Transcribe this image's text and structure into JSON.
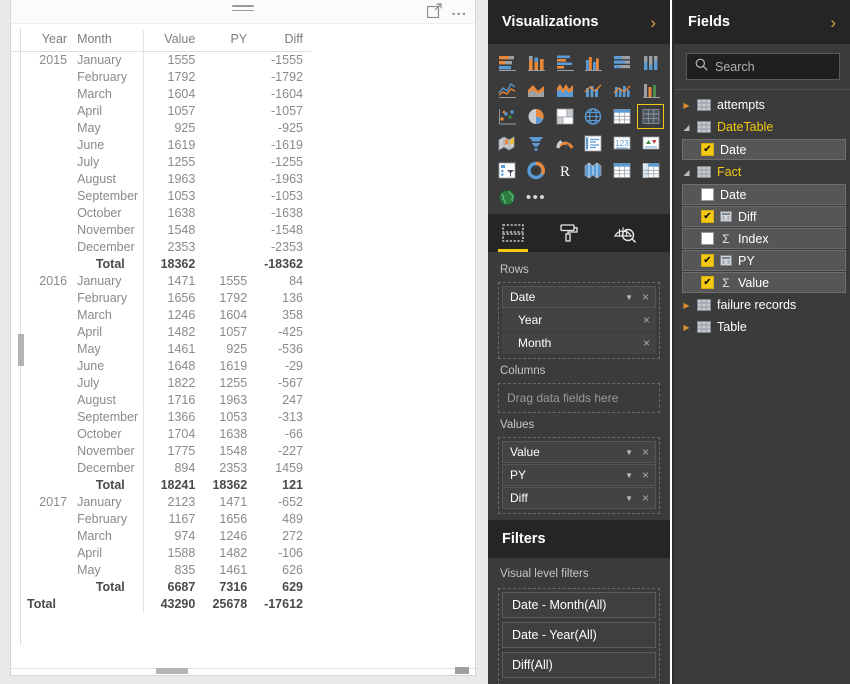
{
  "visual": {
    "drag_handle": "drag-handle",
    "focus_mode_label": "focus-mode",
    "more_options_label": "...",
    "columns": [
      "Year",
      "Month",
      "Value",
      "PY",
      "Diff"
    ],
    "rows": [
      {
        "type": "data",
        "year": "2015",
        "month": "January",
        "value": "1555",
        "py": "",
        "diff": "-1555"
      },
      {
        "type": "data",
        "year": "",
        "month": "February",
        "value": "1792",
        "py": "",
        "diff": "-1792"
      },
      {
        "type": "data",
        "year": "",
        "month": "March",
        "value": "1604",
        "py": "",
        "diff": "-1604"
      },
      {
        "type": "data",
        "year": "",
        "month": "April",
        "value": "1057",
        "py": "",
        "diff": "-1057"
      },
      {
        "type": "data",
        "year": "",
        "month": "May",
        "value": "925",
        "py": "",
        "diff": "-925"
      },
      {
        "type": "data",
        "year": "",
        "month": "June",
        "value": "1619",
        "py": "",
        "diff": "-1619"
      },
      {
        "type": "data",
        "year": "",
        "month": "July",
        "value": "1255",
        "py": "",
        "diff": "-1255"
      },
      {
        "type": "data",
        "year": "",
        "month": "August",
        "value": "1963",
        "py": "",
        "diff": "-1963"
      },
      {
        "type": "data",
        "year": "",
        "month": "September",
        "value": "1053",
        "py": "",
        "diff": "-1053"
      },
      {
        "type": "data",
        "year": "",
        "month": "October",
        "value": "1638",
        "py": "",
        "diff": "-1638"
      },
      {
        "type": "data",
        "year": "",
        "month": "November",
        "value": "1548",
        "py": "",
        "diff": "-1548"
      },
      {
        "type": "data",
        "year": "",
        "month": "December",
        "value": "2353",
        "py": "",
        "diff": "-2353"
      },
      {
        "type": "total",
        "year": "",
        "month": "Total",
        "value": "18362",
        "py": "",
        "diff": "-18362"
      },
      {
        "type": "data",
        "year": "2016",
        "month": "January",
        "value": "1471",
        "py": "1555",
        "diff": "84"
      },
      {
        "type": "data",
        "year": "",
        "month": "February",
        "value": "1656",
        "py": "1792",
        "diff": "136"
      },
      {
        "type": "data",
        "year": "",
        "month": "March",
        "value": "1246",
        "py": "1604",
        "diff": "358"
      },
      {
        "type": "data",
        "year": "",
        "month": "April",
        "value": "1482",
        "py": "1057",
        "diff": "-425"
      },
      {
        "type": "data",
        "year": "",
        "month": "May",
        "value": "1461",
        "py": "925",
        "diff": "-536"
      },
      {
        "type": "data",
        "year": "",
        "month": "June",
        "value": "1648",
        "py": "1619",
        "diff": "-29"
      },
      {
        "type": "data",
        "year": "",
        "month": "July",
        "value": "1822",
        "py": "1255",
        "diff": "-567"
      },
      {
        "type": "data",
        "year": "",
        "month": "August",
        "value": "1716",
        "py": "1963",
        "diff": "247"
      },
      {
        "type": "data",
        "year": "",
        "month": "September",
        "value": "1366",
        "py": "1053",
        "diff": "-313"
      },
      {
        "type": "data",
        "year": "",
        "month": "October",
        "value": "1704",
        "py": "1638",
        "diff": "-66"
      },
      {
        "type": "data",
        "year": "",
        "month": "November",
        "value": "1775",
        "py": "1548",
        "diff": "-227"
      },
      {
        "type": "data",
        "year": "",
        "month": "December",
        "value": "894",
        "py": "2353",
        "diff": "1459"
      },
      {
        "type": "total",
        "year": "",
        "month": "Total",
        "value": "18241",
        "py": "18362",
        "diff": "121"
      },
      {
        "type": "data",
        "year": "2017",
        "month": "January",
        "value": "2123",
        "py": "1471",
        "diff": "-652"
      },
      {
        "type": "data",
        "year": "",
        "month": "February",
        "value": "1167",
        "py": "1656",
        "diff": "489"
      },
      {
        "type": "data",
        "year": "",
        "month": "March",
        "value": "974",
        "py": "1246",
        "diff": "272"
      },
      {
        "type": "data",
        "year": "",
        "month": "April",
        "value": "1588",
        "py": "1482",
        "diff": "-106"
      },
      {
        "type": "data",
        "year": "",
        "month": "May",
        "value": "835",
        "py": "1461",
        "diff": "626"
      },
      {
        "type": "total",
        "year": "",
        "month": "Total",
        "value": "6687",
        "py": "7316",
        "diff": "629"
      },
      {
        "type": "grand",
        "year": "Total",
        "month": "",
        "value": "43290",
        "py": "25678",
        "diff": "-17612"
      }
    ]
  },
  "visualizations": {
    "title": "Visualizations",
    "expand_chevron": "›",
    "gallery": [
      {
        "name": "stacked-bar-chart-icon",
        "selected": false
      },
      {
        "name": "stacked-column-chart-icon",
        "selected": false
      },
      {
        "name": "clustered-bar-chart-icon",
        "selected": false
      },
      {
        "name": "clustered-column-chart-icon",
        "selected": false
      },
      {
        "name": "hundred-percent-stacked-bar-chart-icon",
        "selected": false
      },
      {
        "name": "hundred-percent-stacked-column-chart-icon",
        "selected": false
      },
      {
        "name": "line-chart-icon",
        "selected": false
      },
      {
        "name": "area-chart-icon",
        "selected": false
      },
      {
        "name": "stacked-area-chart-icon",
        "selected": false
      },
      {
        "name": "line-and-stacked-column-chart-icon",
        "selected": false
      },
      {
        "name": "line-and-clustered-column-chart-icon",
        "selected": false
      },
      {
        "name": "ribbon-chart-icon",
        "selected": false
      },
      {
        "name": "scatter-chart-icon",
        "selected": false
      },
      {
        "name": "pie-chart-icon",
        "selected": false
      },
      {
        "name": "treemap-icon",
        "selected": false
      },
      {
        "name": "map-icon",
        "selected": false
      },
      {
        "name": "table-icon",
        "selected": false
      },
      {
        "name": "matrix-icon",
        "selected": true
      },
      {
        "name": "filled-map-icon",
        "selected": false
      },
      {
        "name": "funnel-chart-icon",
        "selected": false
      },
      {
        "name": "gauge-icon",
        "selected": false
      },
      {
        "name": "multi-row-card-icon",
        "selected": false
      },
      {
        "name": "card-icon",
        "selected": false
      },
      {
        "name": "kpi-icon",
        "selected": false
      },
      {
        "name": "slicer-icon",
        "selected": false
      },
      {
        "name": "donut-chart-icon",
        "selected": false
      },
      {
        "name": "r-script-visual-icon",
        "selected": false
      },
      {
        "name": "shape-map-icon",
        "selected": false
      },
      {
        "name": "table-alt-icon",
        "selected": false
      },
      {
        "name": "matrix-alt-icon",
        "selected": false
      },
      {
        "name": "globe-map-icon",
        "selected": false
      },
      {
        "name": "more-visuals-icon",
        "selected": false
      }
    ],
    "tabs": [
      {
        "name": "fields-tab",
        "active": true
      },
      {
        "name": "format-tab",
        "active": false
      },
      {
        "name": "analytics-tab",
        "active": false
      }
    ],
    "wells": {
      "rows_label": "Rows",
      "rows_items": [
        {
          "label": "Date",
          "child": false
        },
        {
          "label": "Year",
          "child": true
        },
        {
          "label": "Month",
          "child": true
        }
      ],
      "columns_label": "Columns",
      "columns_placeholder": "Drag data fields here",
      "values_label": "Values",
      "values_items": [
        {
          "label": "Value"
        },
        {
          "label": "PY"
        },
        {
          "label": "Diff"
        }
      ],
      "remove_glyph": "×",
      "caret_glyph": "▼"
    }
  },
  "filters": {
    "title": "Filters",
    "subtitle": "Visual level filters",
    "cards": [
      {
        "label": "Date - Month(All)"
      },
      {
        "label": "Date - Year(All)"
      },
      {
        "label": "Diff(All)"
      }
    ]
  },
  "fields": {
    "title": "Fields",
    "expand_chevron": "›",
    "search_placeholder": "Search",
    "tables": [
      {
        "name": "attempts",
        "expanded": false,
        "highlighted": false,
        "fields": []
      },
      {
        "name": "DateTable",
        "expanded": true,
        "highlighted": true,
        "fields": [
          {
            "label": "Date",
            "checked": true,
            "icon": "none"
          }
        ]
      },
      {
        "name": "Fact",
        "expanded": true,
        "highlighted": true,
        "fields": [
          {
            "label": "Date",
            "checked": false,
            "icon": "none"
          },
          {
            "label": "Diff",
            "checked": true,
            "icon": "measure"
          },
          {
            "label": "Index",
            "checked": false,
            "icon": "sigma"
          },
          {
            "label": "PY",
            "checked": true,
            "icon": "measure"
          },
          {
            "label": "Value",
            "checked": true,
            "icon": "sigma"
          }
        ]
      },
      {
        "name": "failure records",
        "expanded": false,
        "highlighted": false,
        "fields": []
      },
      {
        "name": "Table",
        "expanded": false,
        "highlighted": false,
        "fields": []
      }
    ],
    "check_glyph": "✔",
    "expand_glyph": "▶",
    "collapse_glyph": "◢"
  },
  "colors": {
    "accent_yellow": "#f2c811",
    "pane_bg": "#3b3b3b",
    "pane_header_bg": "#252525",
    "canvas_bg": "#e9e9e9",
    "visual_bg": "#ffffff",
    "table_text": "#8a8a8a",
    "table_total_text": "#4a4a4a"
  }
}
